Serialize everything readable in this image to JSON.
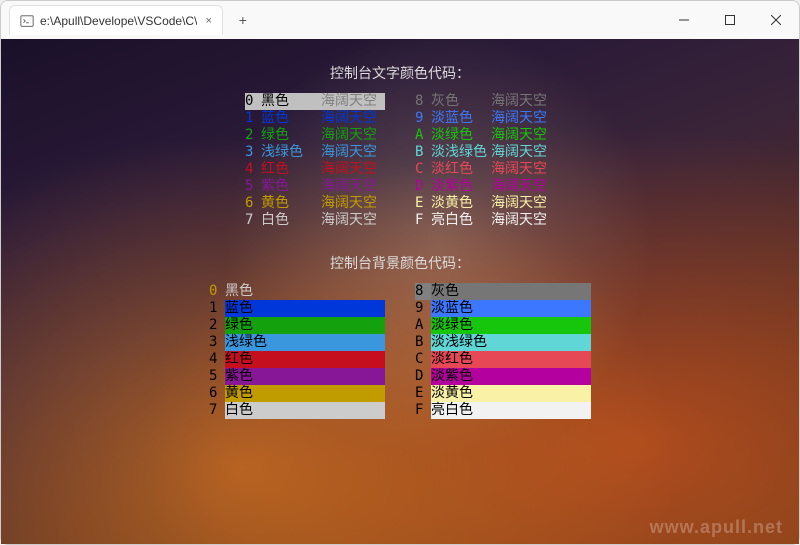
{
  "window": {
    "tab_title": "e:\\Apull\\Develope\\VSCode\\C\\",
    "tab_close": "×",
    "new_tab": "+",
    "minimize": "—",
    "maximize": "▢",
    "close": "×"
  },
  "headers": {
    "fg_title": "控制台文字颜色代码：",
    "bg_title": "控制台背景颜色代码："
  },
  "sample_text": "海阔天空",
  "fg_left": [
    {
      "code": "0",
      "name": "黑色",
      "color": "#000000",
      "sample": "#808080",
      "highlight": true
    },
    {
      "code": "1",
      "name": "蓝色",
      "color": "#0037DA",
      "sample": "#0037DA"
    },
    {
      "code": "2",
      "name": "绿色",
      "color": "#13A10E",
      "sample": "#13A10E"
    },
    {
      "code": "3",
      "name": "浅绿色",
      "color": "#3A96DD",
      "sample": "#3A96DD"
    },
    {
      "code": "4",
      "name": "红色",
      "color": "#C50F1F",
      "sample": "#C50F1F"
    },
    {
      "code": "5",
      "name": "紫色",
      "color": "#881798",
      "sample": "#881798"
    },
    {
      "code": "6",
      "name": "黄色",
      "color": "#C19C00",
      "sample": "#C19C00"
    },
    {
      "code": "7",
      "name": "白色",
      "color": "#CCCCCC",
      "sample": "#CCCCCC"
    }
  ],
  "fg_right": [
    {
      "code": "8",
      "name": "灰色",
      "color": "#767676",
      "sample": "#767676"
    },
    {
      "code": "9",
      "name": "淡蓝色",
      "color": "#3B78FF",
      "sample": "#3B78FF"
    },
    {
      "code": "A",
      "name": "淡绿色",
      "color": "#16C60C",
      "sample": "#16C60C"
    },
    {
      "code": "B",
      "name": "淡浅绿色",
      "color": "#61D6D6",
      "sample": "#61D6D6"
    },
    {
      "code": "C",
      "name": "淡红色",
      "color": "#E74856",
      "sample": "#E74856"
    },
    {
      "code": "D",
      "name": "淡紫色",
      "color": "#B4009E",
      "sample": "#B4009E"
    },
    {
      "code": "E",
      "name": "淡黄色",
      "color": "#F9F1A5",
      "sample": "#F9F1A5"
    },
    {
      "code": "F",
      "name": "亮白色",
      "color": "#F2F2F2",
      "sample": "#F2F2F2"
    }
  ],
  "bg_left": [
    {
      "code": "0",
      "name": "黑色",
      "bg": null,
      "code_color": "#C19C00"
    },
    {
      "code": "1",
      "name": "蓝色",
      "bg": "#0037DA",
      "code_color": null
    },
    {
      "code": "2",
      "name": "绿色",
      "bg": "#13A10E",
      "code_color": null
    },
    {
      "code": "3",
      "name": "浅绿色",
      "bg": "#3A96DD",
      "code_color": null
    },
    {
      "code": "4",
      "name": "红色",
      "bg": "#C50F1F",
      "code_color": null
    },
    {
      "code": "5",
      "name": "紫色",
      "bg": "#881798",
      "code_color": null
    },
    {
      "code": "6",
      "name": "黄色",
      "bg": "#C19C00",
      "code_color": null
    },
    {
      "code": "7",
      "name": "白色",
      "bg": "#CCCCCC",
      "code_color": null
    }
  ],
  "bg_right": [
    {
      "code": "8",
      "name": "灰色",
      "bg": "#767676",
      "code_color": null,
      "highlight": true
    },
    {
      "code": "9",
      "name": "淡蓝色",
      "bg": "#3B78FF",
      "code_color": null
    },
    {
      "code": "A",
      "name": "淡绿色",
      "bg": "#16C60C",
      "code_color": null
    },
    {
      "code": "B",
      "name": "淡浅绿色",
      "bg": "#61D6D6",
      "code_color": null
    },
    {
      "code": "C",
      "name": "淡红色",
      "bg": "#E74856",
      "code_color": null
    },
    {
      "code": "D",
      "name": "淡紫色",
      "bg": "#B4009E",
      "code_color": null
    },
    {
      "code": "E",
      "name": "淡黄色",
      "bg": "#F9F1A5",
      "code_color": null
    },
    {
      "code": "F",
      "name": "亮白色",
      "bg": "#F2F2F2",
      "code_color": null
    }
  ],
  "watermark": "www.apull.net"
}
